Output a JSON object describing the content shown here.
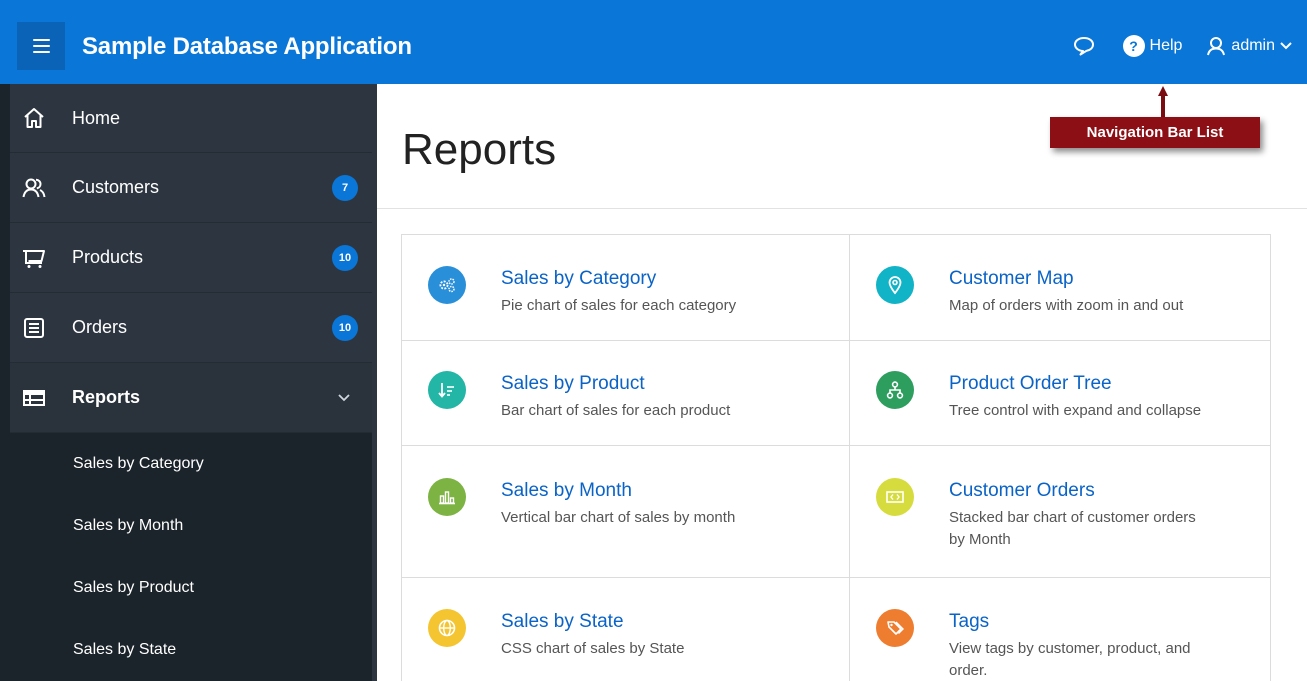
{
  "header": {
    "app_title": "Sample Database Application",
    "help_label": "Help",
    "help_glyph": "?",
    "user_label": "admin",
    "accent_color": "#0a76d8"
  },
  "callout": {
    "label": "Navigation Bar List"
  },
  "sidebar": {
    "items": [
      {
        "label": "Home",
        "icon": "home-icon"
      },
      {
        "label": "Customers",
        "icon": "customers-icon",
        "badge": "7"
      },
      {
        "label": "Products",
        "icon": "cart-icon",
        "badge": "10"
      },
      {
        "label": "Orders",
        "icon": "orders-icon",
        "badge": "10"
      },
      {
        "label": "Reports",
        "icon": "table-icon",
        "expanded": true
      }
    ],
    "sub_items": [
      {
        "label": "Sales by Category"
      },
      {
        "label": "Sales by Month"
      },
      {
        "label": "Sales by Product"
      },
      {
        "label": "Sales by State"
      }
    ]
  },
  "main": {
    "page_title": "Reports",
    "cards": [
      {
        "title": "Sales by Category",
        "desc": "Pie chart of sales for each category",
        "icon": "gears-icon",
        "color": "#2a8fd9"
      },
      {
        "title": "Customer Map",
        "desc": "Map of orders with zoom in and out",
        "icon": "map-pin-icon",
        "color": "#11b3c7"
      },
      {
        "title": "Sales by Product",
        "desc": "Bar chart of sales for each product",
        "icon": "sort-icon",
        "color": "#23b5a5"
      },
      {
        "title": "Product Order Tree",
        "desc": "Tree control with expand and collapse",
        "icon": "tree-icon",
        "color": "#2e9e5f"
      },
      {
        "title": "Sales by Month",
        "desc": "Vertical bar chart of sales by month",
        "icon": "bar-chart-icon",
        "color": "#7cb342"
      },
      {
        "title": "Customer Orders",
        "desc": "Stacked bar chart of customer orders",
        "desc2": "by Month",
        "icon": "money-icon",
        "color": "#d6dc3e"
      },
      {
        "title": "Sales by State",
        "desc": "CSS chart of sales by State",
        "icon": "globe-icon",
        "color": "#f4c531"
      },
      {
        "title": "Tags",
        "desc": "View tags by customer, product, and",
        "desc2": "order.",
        "icon": "tags-icon",
        "color": "#ef7d30"
      }
    ]
  }
}
